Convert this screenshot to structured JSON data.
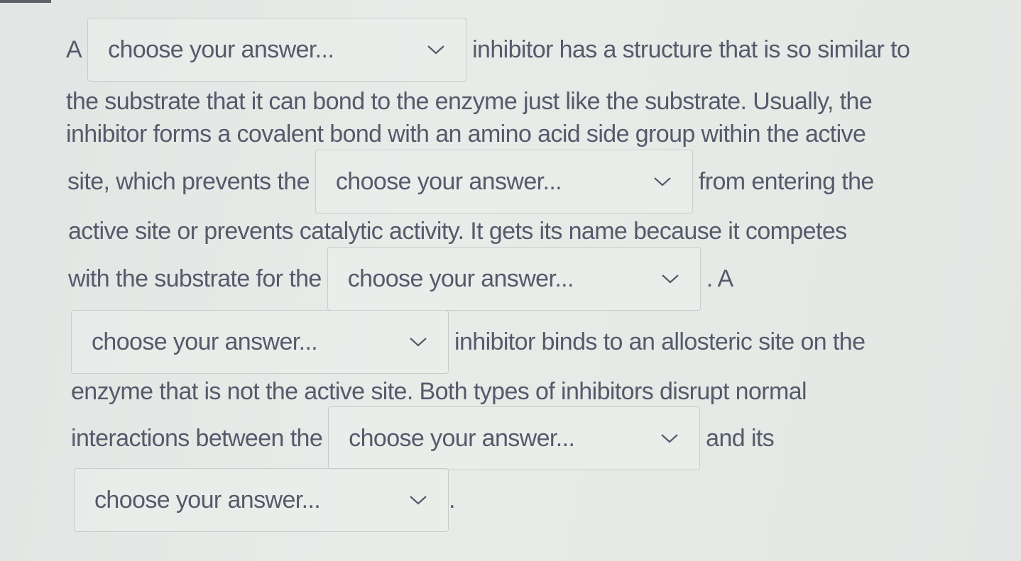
{
  "question": {
    "dropdown_placeholder": "choose your answer...",
    "dropdown_icon": "chevron-down-icon",
    "segments": {
      "s1_before": "A",
      "s1_after": "inhibitor has a structure that is so similar to",
      "s2": "the substrate that it can bond to the enzyme just like the substrate.  Usually, the",
      "s3": "inhibitor forms a covalent bond with an amino acid side group within the active",
      "s4_before": "site, which prevents the",
      "s4_after": "from entering the",
      "s5": "active site or prevents catalytic activity.  It gets its name because it competes",
      "s6_before": "with the substrate for the",
      "s6_after": ". A",
      "s7_after": "inhibitor binds to an allosteric site on the",
      "s8": "enzyme that is not the active site. Both types of inhibitors disrupt normal",
      "s9_before": "interactions between the",
      "s9_after": "and its",
      "s10_after": "."
    },
    "dropdowns": [
      {
        "id": 1,
        "selected": "choose your answer..."
      },
      {
        "id": 2,
        "selected": "choose your answer..."
      },
      {
        "id": 3,
        "selected": "choose your answer..."
      },
      {
        "id": 4,
        "selected": "choose your answer..."
      },
      {
        "id": 5,
        "selected": "choose your answer..."
      },
      {
        "id": 6,
        "selected": "choose your answer..."
      }
    ]
  }
}
